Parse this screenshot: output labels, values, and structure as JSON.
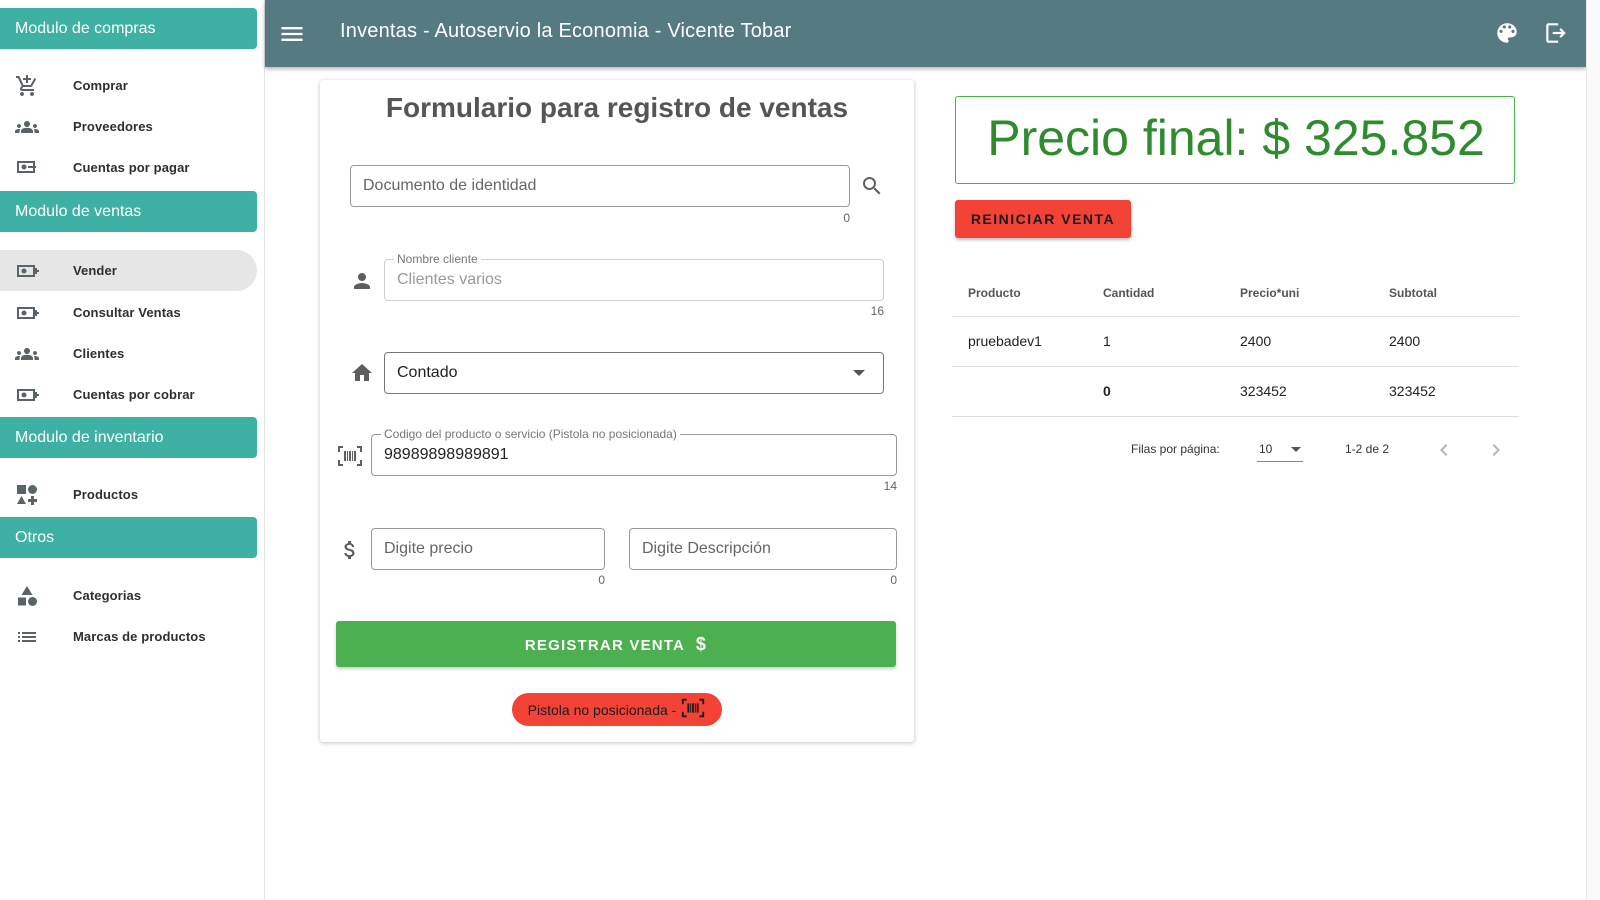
{
  "app": {
    "title": "Inventas - Autoservio la Economia - Vicente Tobar"
  },
  "topbar": {
    "icons": [
      "menu-icon",
      "palette-icon",
      "logout-icon"
    ]
  },
  "sidebar": {
    "sections": [
      {
        "header": "Modulo de compras",
        "items": [
          {
            "label": "Comprar",
            "icon": "cart-plus-icon"
          },
          {
            "label": "Proveedores",
            "icon": "group-icon"
          },
          {
            "label": "Cuentas por pagar",
            "icon": "cash-minus-icon"
          }
        ]
      },
      {
        "header": "Modulo de ventas",
        "items": [
          {
            "label": "Vender",
            "icon": "cash-plus-icon",
            "active": true
          },
          {
            "label": "Consultar Ventas",
            "icon": "cash-plus-icon"
          },
          {
            "label": "Clientes",
            "icon": "group-icon"
          },
          {
            "label": "Cuentas por cobrar",
            "icon": "cash-plus-icon"
          }
        ]
      },
      {
        "header": "Modulo de inventario",
        "items": [
          {
            "label": "Productos",
            "icon": "shapes-plus-icon"
          }
        ]
      },
      {
        "header": "Otros",
        "items": [
          {
            "label": "Categorias",
            "icon": "shapes-icon"
          },
          {
            "label": "Marcas de productos",
            "icon": "list-icon"
          }
        ]
      }
    ]
  },
  "form": {
    "title": "Formulario para registro de ventas",
    "document": {
      "placeholder": "Documento de identidad",
      "value": "",
      "counter": "0"
    },
    "client": {
      "label": "Nombre cliente",
      "placeholder": "Clientes varios",
      "counter": "16"
    },
    "payment": {
      "selected": "Contado"
    },
    "product_code": {
      "label": "Codigo del producto o servicio (Pistola no posicionada)",
      "value": "98989898989891",
      "counter": "14"
    },
    "price": {
      "placeholder": "Digite precio",
      "counter": "0"
    },
    "description": {
      "placeholder": "Digite Descripción",
      "counter": "0"
    },
    "register_button": "REGISTRAR VENTA",
    "scanner_status": "Pistola no posicionada -"
  },
  "summary": {
    "final_price": "Precio final: $ 325.852",
    "reset_button": "REINICIAR VENTA"
  },
  "table": {
    "headers": [
      "Producto",
      "Cantidad",
      "Precio*uni",
      "Subtotal"
    ],
    "rows": [
      [
        "pruebadev1",
        "1",
        "2400",
        "2400"
      ],
      [
        "",
        "0",
        "323452",
        "323452"
      ]
    ],
    "rows_per_page_label": "Filas por página:",
    "rows_per_page": "10",
    "page_range": "1-2 de 2"
  },
  "colors": {
    "topbar": "#557a82",
    "section_header": "#3fb1a4",
    "register": "#4caf50",
    "reset": "#f44336",
    "price_text": "#2e8b2e"
  }
}
